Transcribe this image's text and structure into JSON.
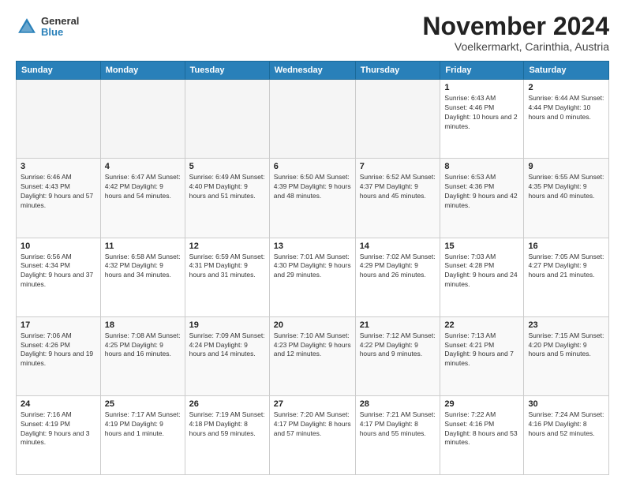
{
  "logo": {
    "line1": "General",
    "line2": "Blue"
  },
  "title": "November 2024",
  "subtitle": "Voelkermarkt, Carinthia, Austria",
  "header_days": [
    "Sunday",
    "Monday",
    "Tuesday",
    "Wednesday",
    "Thursday",
    "Friday",
    "Saturday"
  ],
  "weeks": [
    [
      {
        "day": "",
        "info": ""
      },
      {
        "day": "",
        "info": ""
      },
      {
        "day": "",
        "info": ""
      },
      {
        "day": "",
        "info": ""
      },
      {
        "day": "",
        "info": ""
      },
      {
        "day": "1",
        "info": "Sunrise: 6:43 AM\nSunset: 4:46 PM\nDaylight: 10 hours\nand 2 minutes."
      },
      {
        "day": "2",
        "info": "Sunrise: 6:44 AM\nSunset: 4:44 PM\nDaylight: 10 hours\nand 0 minutes."
      }
    ],
    [
      {
        "day": "3",
        "info": "Sunrise: 6:46 AM\nSunset: 4:43 PM\nDaylight: 9 hours\nand 57 minutes."
      },
      {
        "day": "4",
        "info": "Sunrise: 6:47 AM\nSunset: 4:42 PM\nDaylight: 9 hours\nand 54 minutes."
      },
      {
        "day": "5",
        "info": "Sunrise: 6:49 AM\nSunset: 4:40 PM\nDaylight: 9 hours\nand 51 minutes."
      },
      {
        "day": "6",
        "info": "Sunrise: 6:50 AM\nSunset: 4:39 PM\nDaylight: 9 hours\nand 48 minutes."
      },
      {
        "day": "7",
        "info": "Sunrise: 6:52 AM\nSunset: 4:37 PM\nDaylight: 9 hours\nand 45 minutes."
      },
      {
        "day": "8",
        "info": "Sunrise: 6:53 AM\nSunset: 4:36 PM\nDaylight: 9 hours\nand 42 minutes."
      },
      {
        "day": "9",
        "info": "Sunrise: 6:55 AM\nSunset: 4:35 PM\nDaylight: 9 hours\nand 40 minutes."
      }
    ],
    [
      {
        "day": "10",
        "info": "Sunrise: 6:56 AM\nSunset: 4:34 PM\nDaylight: 9 hours\nand 37 minutes."
      },
      {
        "day": "11",
        "info": "Sunrise: 6:58 AM\nSunset: 4:32 PM\nDaylight: 9 hours\nand 34 minutes."
      },
      {
        "day": "12",
        "info": "Sunrise: 6:59 AM\nSunset: 4:31 PM\nDaylight: 9 hours\nand 31 minutes."
      },
      {
        "day": "13",
        "info": "Sunrise: 7:01 AM\nSunset: 4:30 PM\nDaylight: 9 hours\nand 29 minutes."
      },
      {
        "day": "14",
        "info": "Sunrise: 7:02 AM\nSunset: 4:29 PM\nDaylight: 9 hours\nand 26 minutes."
      },
      {
        "day": "15",
        "info": "Sunrise: 7:03 AM\nSunset: 4:28 PM\nDaylight: 9 hours\nand 24 minutes."
      },
      {
        "day": "16",
        "info": "Sunrise: 7:05 AM\nSunset: 4:27 PM\nDaylight: 9 hours\nand 21 minutes."
      }
    ],
    [
      {
        "day": "17",
        "info": "Sunrise: 7:06 AM\nSunset: 4:26 PM\nDaylight: 9 hours\nand 19 minutes."
      },
      {
        "day": "18",
        "info": "Sunrise: 7:08 AM\nSunset: 4:25 PM\nDaylight: 9 hours\nand 16 minutes."
      },
      {
        "day": "19",
        "info": "Sunrise: 7:09 AM\nSunset: 4:24 PM\nDaylight: 9 hours\nand 14 minutes."
      },
      {
        "day": "20",
        "info": "Sunrise: 7:10 AM\nSunset: 4:23 PM\nDaylight: 9 hours\nand 12 minutes."
      },
      {
        "day": "21",
        "info": "Sunrise: 7:12 AM\nSunset: 4:22 PM\nDaylight: 9 hours\nand 9 minutes."
      },
      {
        "day": "22",
        "info": "Sunrise: 7:13 AM\nSunset: 4:21 PM\nDaylight: 9 hours\nand 7 minutes."
      },
      {
        "day": "23",
        "info": "Sunrise: 7:15 AM\nSunset: 4:20 PM\nDaylight: 9 hours\nand 5 minutes."
      }
    ],
    [
      {
        "day": "24",
        "info": "Sunrise: 7:16 AM\nSunset: 4:19 PM\nDaylight: 9 hours\nand 3 minutes."
      },
      {
        "day": "25",
        "info": "Sunrise: 7:17 AM\nSunset: 4:19 PM\nDaylight: 9 hours\nand 1 minute."
      },
      {
        "day": "26",
        "info": "Sunrise: 7:19 AM\nSunset: 4:18 PM\nDaylight: 8 hours\nand 59 minutes."
      },
      {
        "day": "27",
        "info": "Sunrise: 7:20 AM\nSunset: 4:17 PM\nDaylight: 8 hours\nand 57 minutes."
      },
      {
        "day": "28",
        "info": "Sunrise: 7:21 AM\nSunset: 4:17 PM\nDaylight: 8 hours\nand 55 minutes."
      },
      {
        "day": "29",
        "info": "Sunrise: 7:22 AM\nSunset: 4:16 PM\nDaylight: 8 hours\nand 53 minutes."
      },
      {
        "day": "30",
        "info": "Sunrise: 7:24 AM\nSunset: 4:16 PM\nDaylight: 8 hours\nand 52 minutes."
      }
    ]
  ]
}
